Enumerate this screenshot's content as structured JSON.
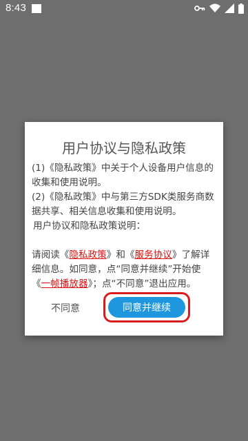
{
  "status_bar": {
    "time": "8:43",
    "icons": [
      "notification-square-icon",
      "key-icon",
      "wifi-icon",
      "signal-icon",
      "battery-icon"
    ],
    "color": "#ffffff"
  },
  "dialog": {
    "title": "用户协议与隐私政策",
    "line1": "(1)《隐私政策》中关于个人设备用户信息的收集和使用说明。",
    "line2": "(2)《隐私政策》中与第三方SDK类服务商数据共享、相关信息收集和使用说明。",
    "line3": "用户协议和隐私政策说明：",
    "notice": {
      "prefix": "请阅读《",
      "privacy_link": "隐私政策",
      "mid1": "》和《",
      "service_link": "服务协议",
      "mid2": "》了解详细信息。如同意，点“同意并继续”开始使《",
      "app_link": "一帧播放器",
      "suffix": "》；点“不同意”退出应用。"
    },
    "disagree_label": "不同意",
    "agree_label": "同意并继续"
  },
  "colors": {
    "overlay": "#6e6e6e",
    "link": "#e01010",
    "accent": "#1f97de",
    "highlight_border": "#d81b1b"
  }
}
